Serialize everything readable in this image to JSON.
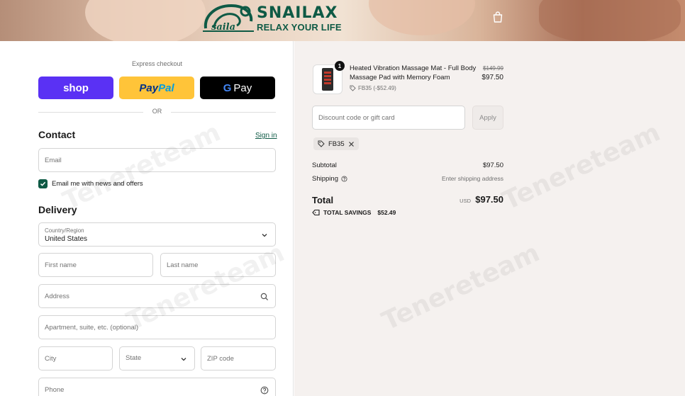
{
  "header": {
    "brand_name": "SNAILAX",
    "tagline": "RELAX YOUR LIFE",
    "cart_icon": "shopping-bag-icon"
  },
  "express": {
    "label": "Express checkout",
    "shop_label": "shop",
    "paypal_label_1": "Pay",
    "paypal_label_2": "Pal",
    "gpay_g": "G",
    "gpay_label": "Pay",
    "or_label": "OR"
  },
  "contact": {
    "heading": "Contact",
    "signin_label": "Sign in",
    "email_placeholder": "Email",
    "news_checked": true,
    "news_label": "Email me with news and offers"
  },
  "delivery": {
    "heading": "Delivery",
    "country_label": "Country/Region",
    "country_value": "United States",
    "first_name_placeholder": "First name",
    "last_name_placeholder": "Last name",
    "address_placeholder": "Address",
    "apartment_placeholder": "Apartment, suite, etc. (optional)",
    "city_placeholder": "City",
    "state_placeholder": "State",
    "zip_placeholder": "ZIP code",
    "phone_placeholder": "Phone"
  },
  "order": {
    "item": {
      "quantity": "1",
      "title": "Heated Vibration Massage Mat - Full Body Massage Pad with Memory Foam",
      "discount_note": "FB35 (-$52.49)",
      "old_price": "$149.99",
      "new_price": "$97.50"
    },
    "discount_placeholder": "Discount code or gift card",
    "apply_label": "Apply",
    "applied_code": "FB35",
    "subtotal_label": "Subtotal",
    "subtotal_value": "$97.50",
    "shipping_label": "Shipping",
    "shipping_value": "Enter shipping address",
    "total_label": "Total",
    "currency": "USD",
    "total_value": "$97.50",
    "savings_label": "TOTAL SAVINGS",
    "savings_value": "$52.49"
  },
  "watermark": "Tenereteam",
  "colors": {
    "brand_green": "#0e5a45",
    "shop_purple": "#5a31f4",
    "paypal_yellow": "#ffc439",
    "summary_bg": "#f5f1ef"
  }
}
